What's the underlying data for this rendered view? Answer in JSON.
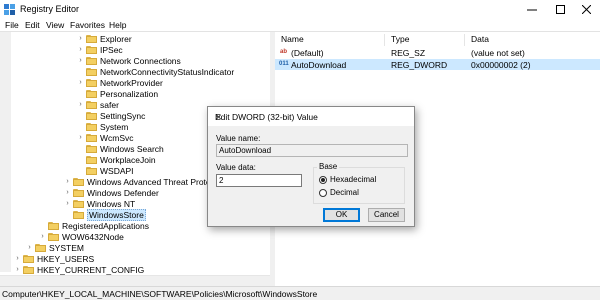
{
  "window": {
    "title": "Registry Editor"
  },
  "menu": [
    "File",
    "Edit",
    "View",
    "Favorites",
    "Help"
  ],
  "tree": {
    "items": [
      {
        "label": "Explorer"
      },
      {
        "label": "IPSec"
      },
      {
        "label": "Network Connections"
      },
      {
        "label": "NetworkConnectivityStatusIndicator"
      },
      {
        "label": "NetworkProvider"
      },
      {
        "label": "Personalization"
      },
      {
        "label": "safer"
      },
      {
        "label": "SettingSync"
      },
      {
        "label": "System"
      },
      {
        "label": "WcmSvc"
      },
      {
        "label": "Windows Search"
      },
      {
        "label": "WorkplaceJoin"
      },
      {
        "label": "WSDAPI"
      },
      {
        "label": "Windows Advanced Threat Protection"
      },
      {
        "label": "Windows Defender"
      },
      {
        "label": "Windows NT"
      },
      {
        "label": "WindowsStore"
      },
      {
        "label": "RegisteredApplications"
      },
      {
        "label": "WOW6432Node"
      },
      {
        "label": "SYSTEM"
      },
      {
        "label": "HKEY_USERS"
      },
      {
        "label": "HKEY_CURRENT_CONFIG"
      }
    ]
  },
  "list": {
    "columns": [
      "Name",
      "Type",
      "Data"
    ],
    "rows": [
      {
        "icon": "ab",
        "name": "(Default)",
        "type": "REG_SZ",
        "data": "(value not set)"
      },
      {
        "icon": "011",
        "name": "AutoDownload",
        "type": "REG_DWORD",
        "data": "0x00000002 (2)"
      }
    ]
  },
  "dialog": {
    "title": "Edit DWORD (32-bit) Value",
    "value_name_label": "Value name:",
    "value_name": "AutoDownload",
    "value_data_label": "Value data:",
    "value_data": "2",
    "base_label": "Base",
    "base_options": [
      "Hexadecimal",
      "Decimal"
    ],
    "base_selected": "Hexadecimal",
    "ok_label": "OK",
    "cancel_label": "Cancel"
  },
  "status": {
    "path": "Computer\\HKEY_LOCAL_MACHINE\\SOFTWARE\\Policies\\Microsoft\\WindowsStore"
  },
  "colors": {
    "selection": "#cce8ff",
    "accent": "#0078d7",
    "folder": "#f3cf62"
  },
  "icons": [
    "registry-editor-icon",
    "folder-icon",
    "string-value-icon",
    "dword-value-icon",
    "minimize-icon",
    "maximize-icon",
    "close-icon"
  ]
}
